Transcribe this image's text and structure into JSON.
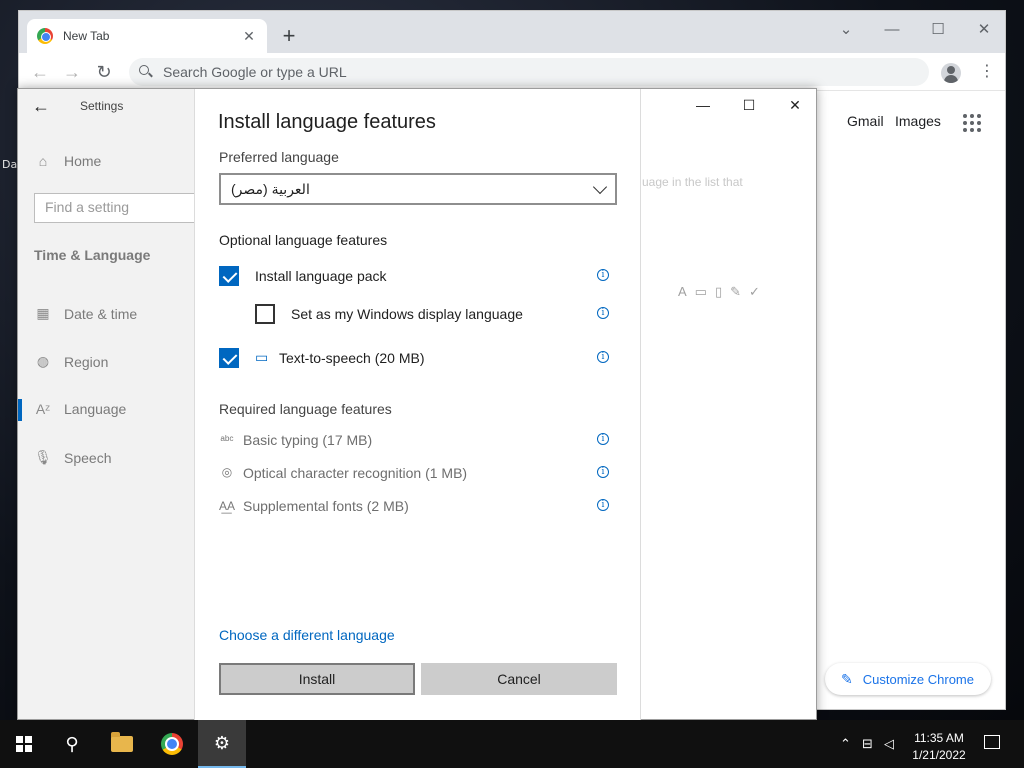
{
  "desktop": {
    "glimpse_text": "Da"
  },
  "chrome": {
    "tab_title": "New Tab",
    "tab_close": "✕",
    "new_tab": "+",
    "window_controls": {
      "dropdown": "⌄",
      "minimize": "—",
      "maximize": "☐",
      "close": "✕"
    },
    "toolbar": {
      "back": "←",
      "forward": "→",
      "reload": "↻",
      "omnibox_placeholder": "Search Google or type a URL",
      "menu": "⋮"
    },
    "links": {
      "gmail": "Gmail",
      "images": "Images"
    },
    "customize_label": "Customize Chrome"
  },
  "settings": {
    "back": "←",
    "app_title": "Settings",
    "nav": {
      "home": "Home",
      "search_placeholder": "Find a setting",
      "section": "Time & Language",
      "items": [
        {
          "label": "Date & time",
          "icon": "calendar-clock-icon"
        },
        {
          "label": "Region",
          "icon": "globe-icon"
        },
        {
          "label": "Language",
          "icon": "language-icon"
        },
        {
          "label": "Speech",
          "icon": "microphone-icon"
        }
      ]
    },
    "window_controls": {
      "minimize": "—",
      "maximize": "☐",
      "close": "✕"
    },
    "faint_text": "uage in the list that",
    "accent_color": "#0067c0"
  },
  "dialog": {
    "title": "Install language features",
    "preferred_language_label": "Preferred language",
    "preferred_language_value": "العربية (مصر)",
    "optional_heading": "Optional language features",
    "optional": [
      {
        "label": "Install language pack",
        "checked": true
      },
      {
        "label": "Set as my Windows display language",
        "checked": false
      },
      {
        "label": "Text-to-speech (20 MB)",
        "checked": true
      }
    ],
    "required_heading": "Required language features",
    "required": [
      {
        "label": "Basic typing (17 MB)",
        "icon_glyph": "ᵃᵇᶜ"
      },
      {
        "label": "Optical character recognition (1 MB)",
        "icon_glyph": "◎"
      },
      {
        "label": "Supplemental fonts (2 MB)",
        "icon_glyph": "A͟A"
      }
    ],
    "info_glyph": "i",
    "choose_link": "Choose a different language",
    "install_button": "Install",
    "cancel_button": "Cancel"
  },
  "taskbar": {
    "clock_time": "11:35 AM",
    "clock_date": "1/21/2022"
  }
}
